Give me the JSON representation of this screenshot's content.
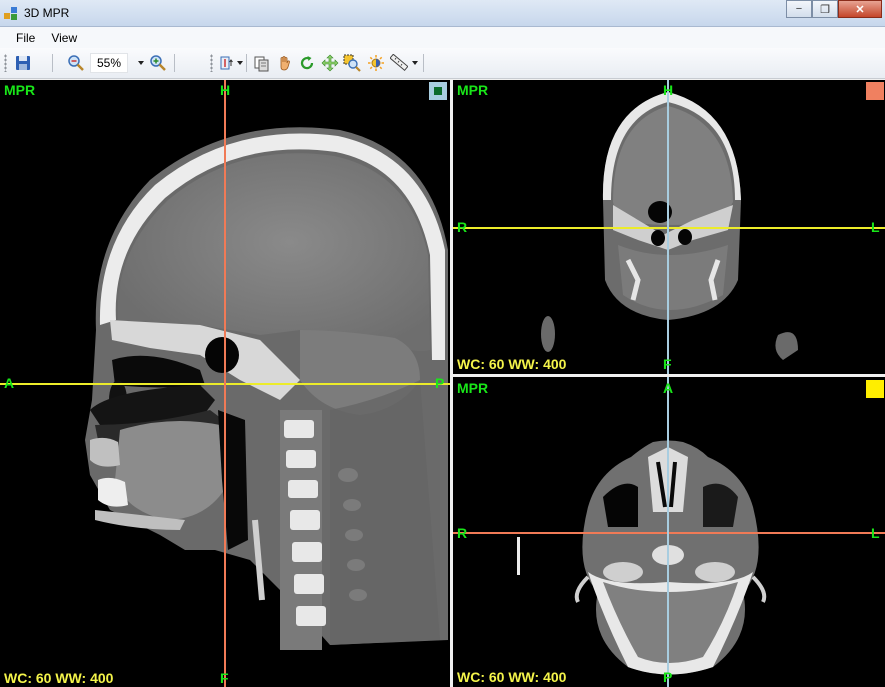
{
  "window": {
    "title": "3D MPR"
  },
  "menu": {
    "file": "File",
    "view": "View"
  },
  "toolbar": {
    "zoom_value": "55%",
    "icons": [
      "save-icon",
      "zoom-out-icon",
      "zoom-in-icon",
      "layout-icon",
      "copy-icon",
      "pan-hand-icon",
      "rotate-icon",
      "move-icon",
      "zoom-rect-icon",
      "window-level-icon",
      "measure-icon"
    ]
  },
  "colors": {
    "green": "#19e619",
    "yellow": "#f4f44a",
    "orange": "#f08060",
    "lightblue": "#a8cde0",
    "crosshair_yellow": "#ecec2a",
    "crosshair_orange": "#f07a56"
  },
  "viewports": {
    "sagittal": {
      "title": "MPR",
      "top": "H",
      "bottom": "F",
      "left": "A",
      "right": "P",
      "wc": "WC: 60 WW: 400"
    },
    "coronal": {
      "title": "MPR",
      "top": "H",
      "bottom": "F",
      "left": "R",
      "right": "L",
      "wc": "WC: 60 WW: 400"
    },
    "axial": {
      "title": "MPR",
      "top": "A",
      "bottom": "P",
      "left": "R",
      "right": "L",
      "wc": "WC: 60 WW: 400"
    }
  }
}
